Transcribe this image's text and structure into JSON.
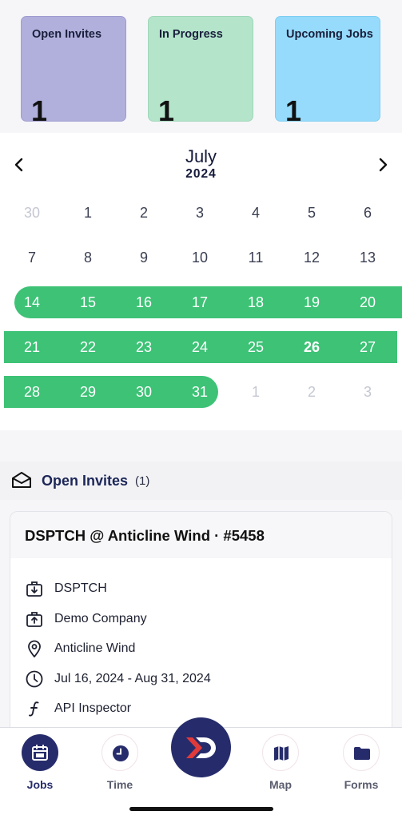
{
  "stats": [
    {
      "label": "Open Invites",
      "count": "1"
    },
    {
      "label": "In Progress",
      "count": "1"
    },
    {
      "label": "Upcoming Jobs",
      "count": "1"
    }
  ],
  "calendar": {
    "month": "July",
    "year": "2024",
    "weeks": [
      [
        "30",
        "1",
        "2",
        "3",
        "4",
        "5",
        "6"
      ],
      [
        "7",
        "8",
        "9",
        "10",
        "11",
        "12",
        "13"
      ],
      [
        "14",
        "15",
        "16",
        "17",
        "18",
        "19",
        "20"
      ],
      [
        "21",
        "22",
        "23",
        "24",
        "25",
        "26",
        "27"
      ],
      [
        "28",
        "29",
        "30",
        "31",
        "1",
        "2",
        "3"
      ]
    ],
    "selected_range": "July 14 - July 31",
    "today": "26",
    "range_color": "#3dc276"
  },
  "section": {
    "title": "Open Invites",
    "count": "(1)",
    "icon": "envelope-open-icon"
  },
  "job": {
    "title": "DSPTCH @ Anticline Wind · #5458",
    "details": [
      {
        "icon": "briefcase-down-icon",
        "text": "DSPTCH"
      },
      {
        "icon": "briefcase-up-icon",
        "text": "Demo Company"
      },
      {
        "icon": "location-pin-icon",
        "text": "Anticline Wind"
      },
      {
        "icon": "clock-icon",
        "text": "Jul 16, 2024 - Aug 31, 2024"
      },
      {
        "icon": "function-icon",
        "text": "API Inspector"
      }
    ]
  },
  "tabs": [
    {
      "label": "Jobs",
      "icon": "calendar-icon",
      "active": true
    },
    {
      "label": "Time",
      "icon": "clock-icon",
      "active": false
    },
    {
      "label": "",
      "icon": "dsptch-logo-icon",
      "active": false
    },
    {
      "label": "Map",
      "icon": "map-icon",
      "active": false
    },
    {
      "label": "Forms",
      "icon": "folder-icon",
      "active": false
    }
  ],
  "colors": {
    "accent": "#262c6b",
    "open_invites": "#b1b0dc",
    "in_progress": "#b4e5cb",
    "upcoming": "#96dbfb"
  }
}
